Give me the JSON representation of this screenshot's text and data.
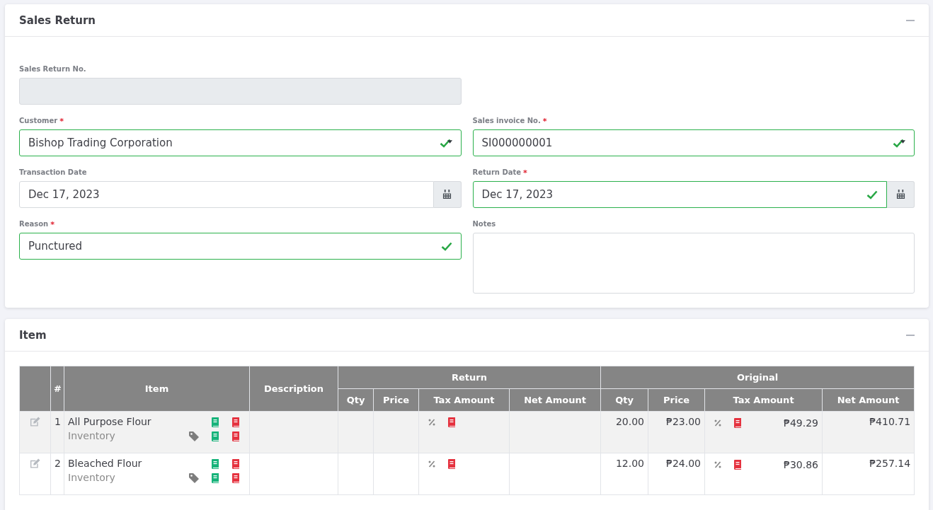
{
  "sales_return": {
    "title": "Sales Return",
    "fields": [
      {
        "kind": "text",
        "label": "Sales Return No.",
        "disabled": true,
        "valid": false
      },
      {
        "kind": "select",
        "label": "Customer",
        "required_mark": "*",
        "value": "Bishop Trading Corporation",
        "valid": true
      },
      {
        "kind": "select",
        "label": "Sales invoice No.",
        "required_mark": "*",
        "value": "SI000000001",
        "valid": true
      },
      {
        "kind": "date",
        "label": "Transaction Date",
        "value": "Dec 17, 2023",
        "valid": false
      },
      {
        "kind": "date",
        "label": "Return Date",
        "required_mark": "*",
        "value": "Dec 17, 2023",
        "valid": true
      },
      {
        "kind": "text",
        "label": "Reason",
        "required_mark": "*",
        "value": "Punctured",
        "valid": true
      },
      {
        "kind": "textarea",
        "label": "Notes",
        "valid": false
      }
    ]
  },
  "item": {
    "title": "Item",
    "table": {
      "head": {
        "number": "#",
        "item": "Item",
        "description": "Description",
        "groups": [
          {
            "label": "Return",
            "columns": [
              "Qty",
              "Price",
              "Tax Amount",
              "Net Amount"
            ]
          },
          {
            "label": "Original",
            "columns": [
              "Qty",
              "Price",
              "Tax Amount",
              "Net Amount"
            ]
          }
        ]
      },
      "rows": [
        {
          "number": "1",
          "item": "All Purpose Flour",
          "type": "Inventory",
          "original_qty": "20.00",
          "original_price": "₱23.00",
          "original_tax": "₱49.29",
          "original_net": "₱410.71"
        },
        {
          "number": "2",
          "item": "Bleached Flour",
          "type": "Inventory",
          "original_qty": "12.00",
          "original_price": "₱24.00",
          "original_tax": "₱30.86",
          "original_net": "₱257.14"
        }
      ]
    }
  }
}
